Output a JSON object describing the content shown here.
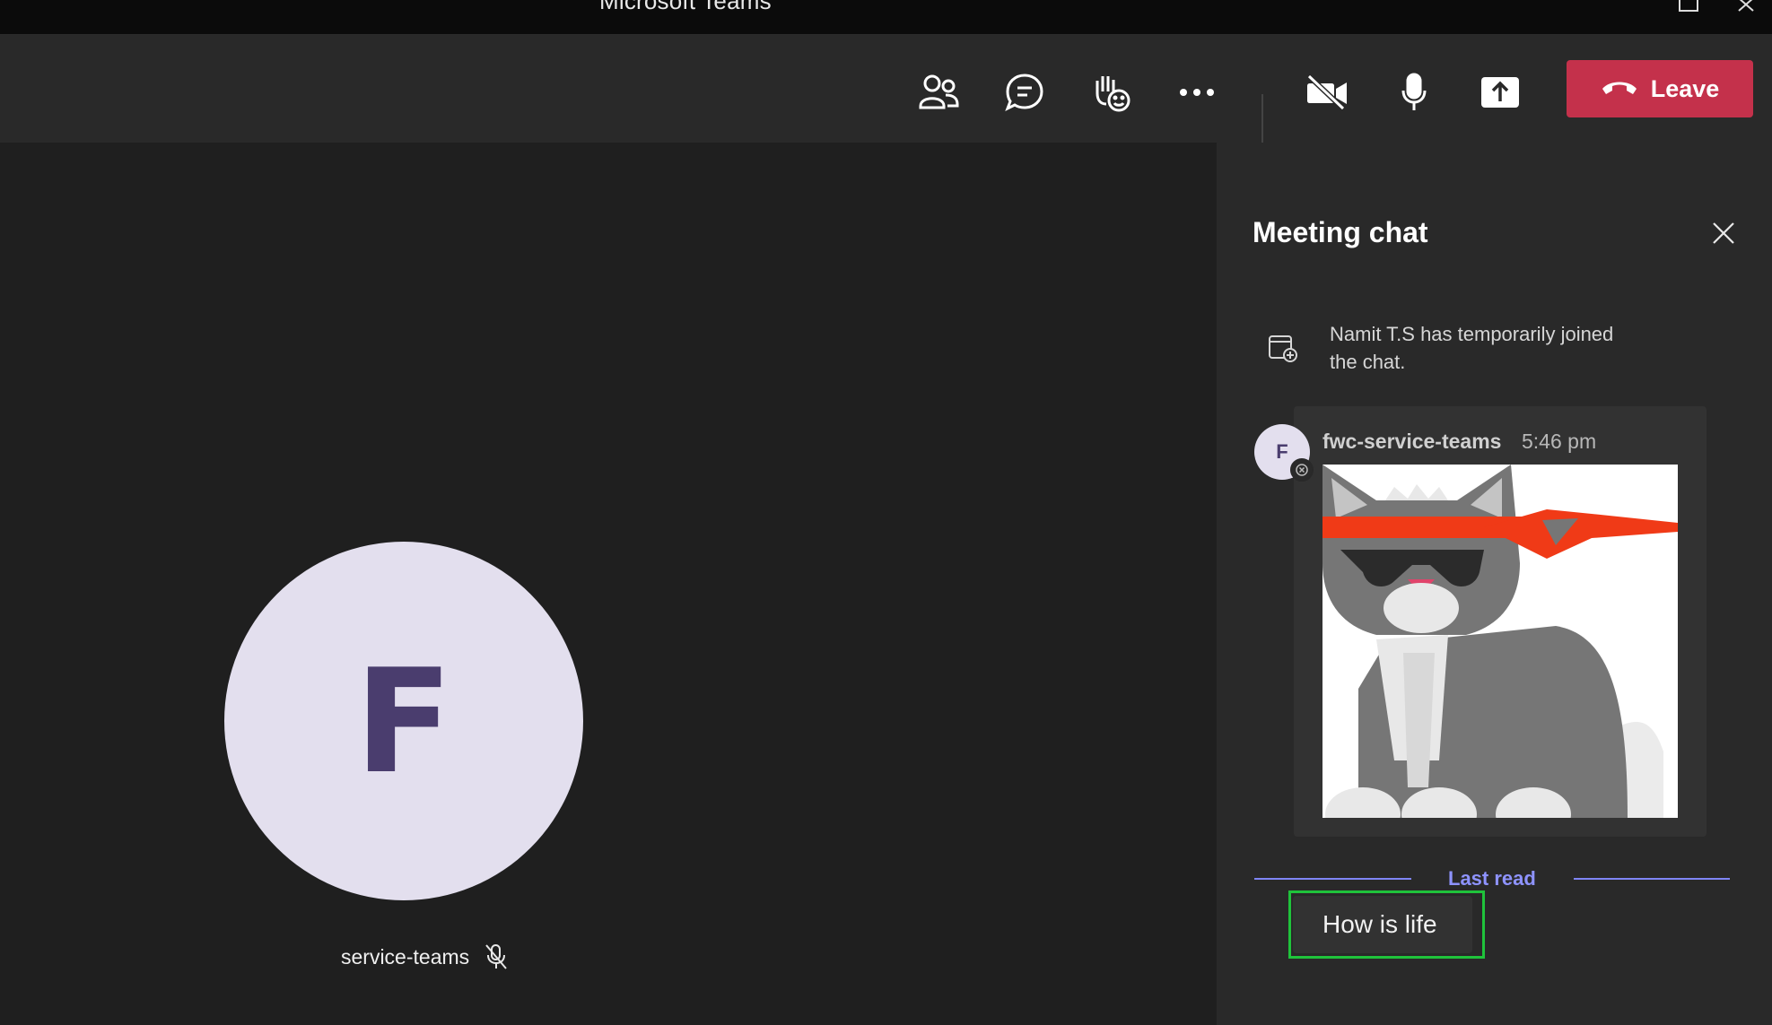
{
  "window": {
    "title": "Microsoft Teams"
  },
  "toolbar": {
    "buttons": [
      {
        "icon": "people-icon",
        "label": "People"
      },
      {
        "icon": "chat-icon",
        "label": "Chat",
        "active": true
      },
      {
        "icon": "reactions-icon",
        "label": "React"
      },
      {
        "icon": "more-icon",
        "label": "More"
      },
      {
        "icon": "camera-off-icon",
        "label": "Camera"
      },
      {
        "icon": "mic-icon",
        "label": "Mic"
      },
      {
        "icon": "share-icon",
        "label": "Share"
      }
    ],
    "leave_label": "Leave"
  },
  "stage": {
    "avatar_initial": "F",
    "participant_name": "service-teams"
  },
  "chat": {
    "title": "Meeting chat",
    "system_message": "Namit T.S has temporarily joined the chat.",
    "message": {
      "avatar_initial": "F",
      "sender": "fwc-service-teams",
      "time": "5:46 pm"
    },
    "last_read_label": "Last read",
    "latest_message": "How is life"
  },
  "colors": {
    "leave": "#c4314b",
    "accent": "#9ea2ff",
    "highlight": "#1fc33b"
  }
}
